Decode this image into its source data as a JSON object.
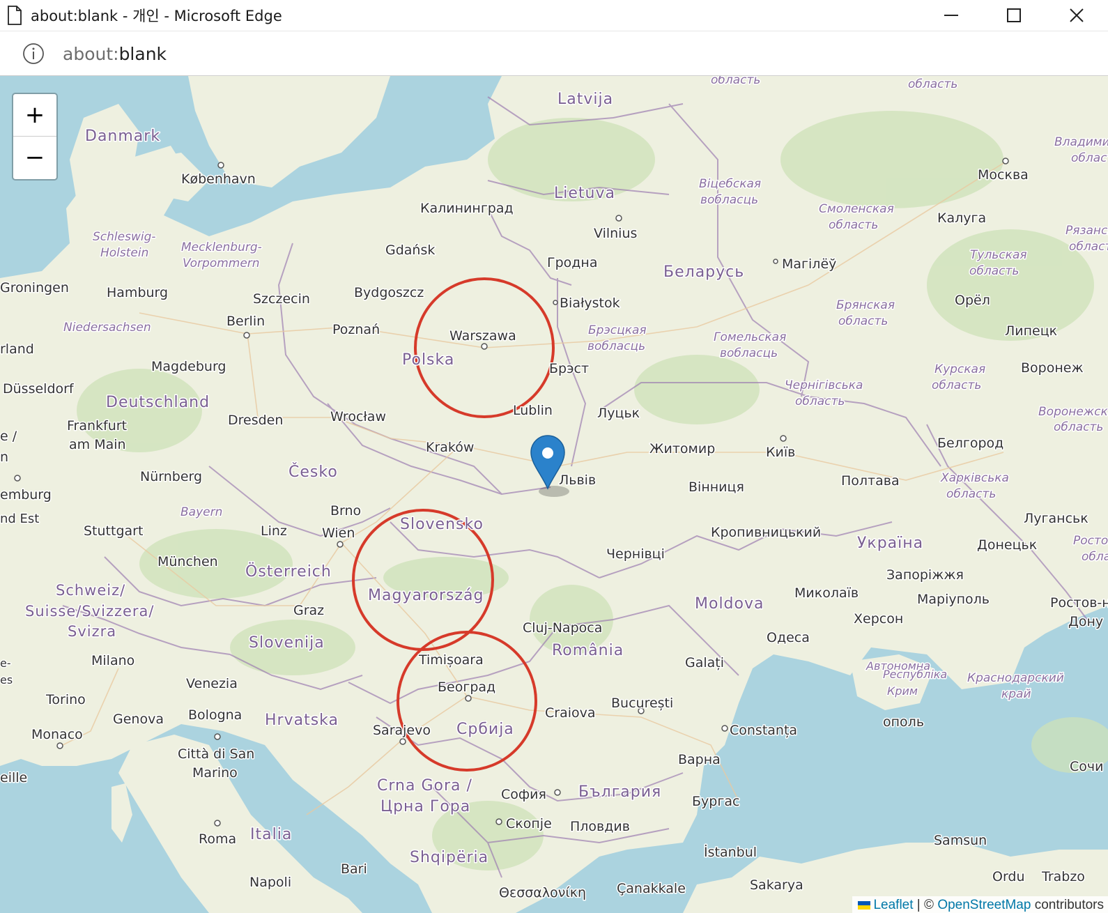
{
  "window": {
    "title": "about:blank - 개인 - Microsoft Edge",
    "icons": [
      "page-icon",
      "minimize-icon",
      "maximize-icon",
      "close-icon"
    ]
  },
  "address_bar": {
    "scheme": "about:",
    "rest": "blank",
    "icon": "info-icon"
  },
  "map": {
    "zoom_in_label": "+",
    "zoom_out_label": "−",
    "countries": [
      "Latvija",
      "Danmark",
      "Lietuva",
      "Беларусь",
      "Polska",
      "Deutschland",
      "Česko",
      "Slovensko",
      "Österreich",
      "Magyarország",
      "Schweiz/",
      "Suisse/Svizzera/",
      "Svizra",
      "Slovenija",
      "Hrvatska",
      "România",
      "Moldova",
      "Україна",
      "Србија",
      "България",
      "Crna Gora /",
      "Црна Гора",
      "Shqipëria",
      "Italia"
    ],
    "cities": [
      "København",
      "Калининград",
      "Vilnius",
      "Gdańsk",
      "Гродна",
      "Магілёў",
      "Москва",
      "Калуга",
      "Groningen",
      "Hamburg",
      "Szczecin",
      "Bydgoszcz",
      "Białystok",
      "Орёл",
      "Berlin",
      "Poznań",
      "Warszawa",
      "Липецк",
      "Magdeburg",
      "Брэст",
      "Воронеж",
      "Düsseldorf",
      "Lublin",
      "Wrocław",
      "Dresden",
      "Луцьк",
      "Frankfurt",
      "am Main",
      "Kraków",
      "Житомир",
      "Київ",
      "Белгород",
      "Nürnberg",
      "Львів",
      "Полтава",
      "emburg",
      "Brno",
      "Вінниця",
      "Луганськ",
      "Stuttgart",
      "Linz",
      "Wien",
      "Кропивницький",
      "München",
      "Донецьк",
      "Чернівці",
      "Запоріжжя",
      "Миколаїв",
      "Маріуполь",
      "Ростов-н",
      "Дону",
      "Graz",
      "Херсон",
      "Cluj-Napoca",
      "Одеса",
      "Milano",
      "Timișoara",
      "Galați",
      "Venezia",
      "Београд",
      "Torino",
      "Genova",
      "Bologna",
      "Craiova",
      "București",
      "Sarajevo",
      "Constanța",
      "Monaco",
      "Città di San",
      "Marino",
      "Варна",
      "eille",
      "София",
      "Бургас",
      "Скопје",
      "Пловдив",
      "Сочи",
      "Roma",
      "Samsun",
      "İstanbul",
      "Bari",
      "Napoli",
      "Θεσσαλονίκη",
      "Çanakkale",
      "Sakarya",
      "Ordu",
      "Trabzo",
      "rland",
      "nd Est",
      "ополь",
      "e /",
      "n",
      "es",
      "e-"
    ],
    "regions": [
      "Schleswig-",
      "Holstein",
      "Mecklenburg-",
      "Vorpommern",
      "Niedersachsen",
      "Bayern",
      "Віцебская",
      "вобласць",
      "Смоленская",
      "область",
      "Брэсцкая",
      "вобласць",
      "Гомельская",
      "вобласць",
      "Брянская",
      "область",
      "Тульская",
      "область",
      "Чернігівська",
      "область",
      "Курская",
      "область",
      "Харківська",
      "область",
      "Автономна",
      "Республіка",
      "Крим",
      "Краснодарский",
      "край",
      "Владимирская",
      "область",
      "Рязанская",
      "область",
      "Воронежская",
      "область",
      "Ростовская",
      "область",
      "область",
      "область"
    ],
    "marker": {
      "icon": "map-marker-icon",
      "color": "#2b82cb",
      "location": "Львів"
    },
    "circles": [
      {
        "center": "Warszawa",
        "color": "#d63a2a"
      },
      {
        "center": "Magyarország",
        "color": "#d63a2a"
      },
      {
        "center": "Београд",
        "color": "#d63a2a"
      }
    ],
    "colors": {
      "sea": "#abd3df",
      "land": "#eef0e0",
      "forest": "#cde2b8",
      "border": "#9e7fb2",
      "label": "#7a5f92"
    }
  },
  "attribution": {
    "leaflet": "Leaflet",
    "separator": " | © ",
    "osm": "OpenStreetMap",
    "suffix": " contributors",
    "flag_colors": [
      "#0057b7",
      "#ffd700"
    ]
  }
}
